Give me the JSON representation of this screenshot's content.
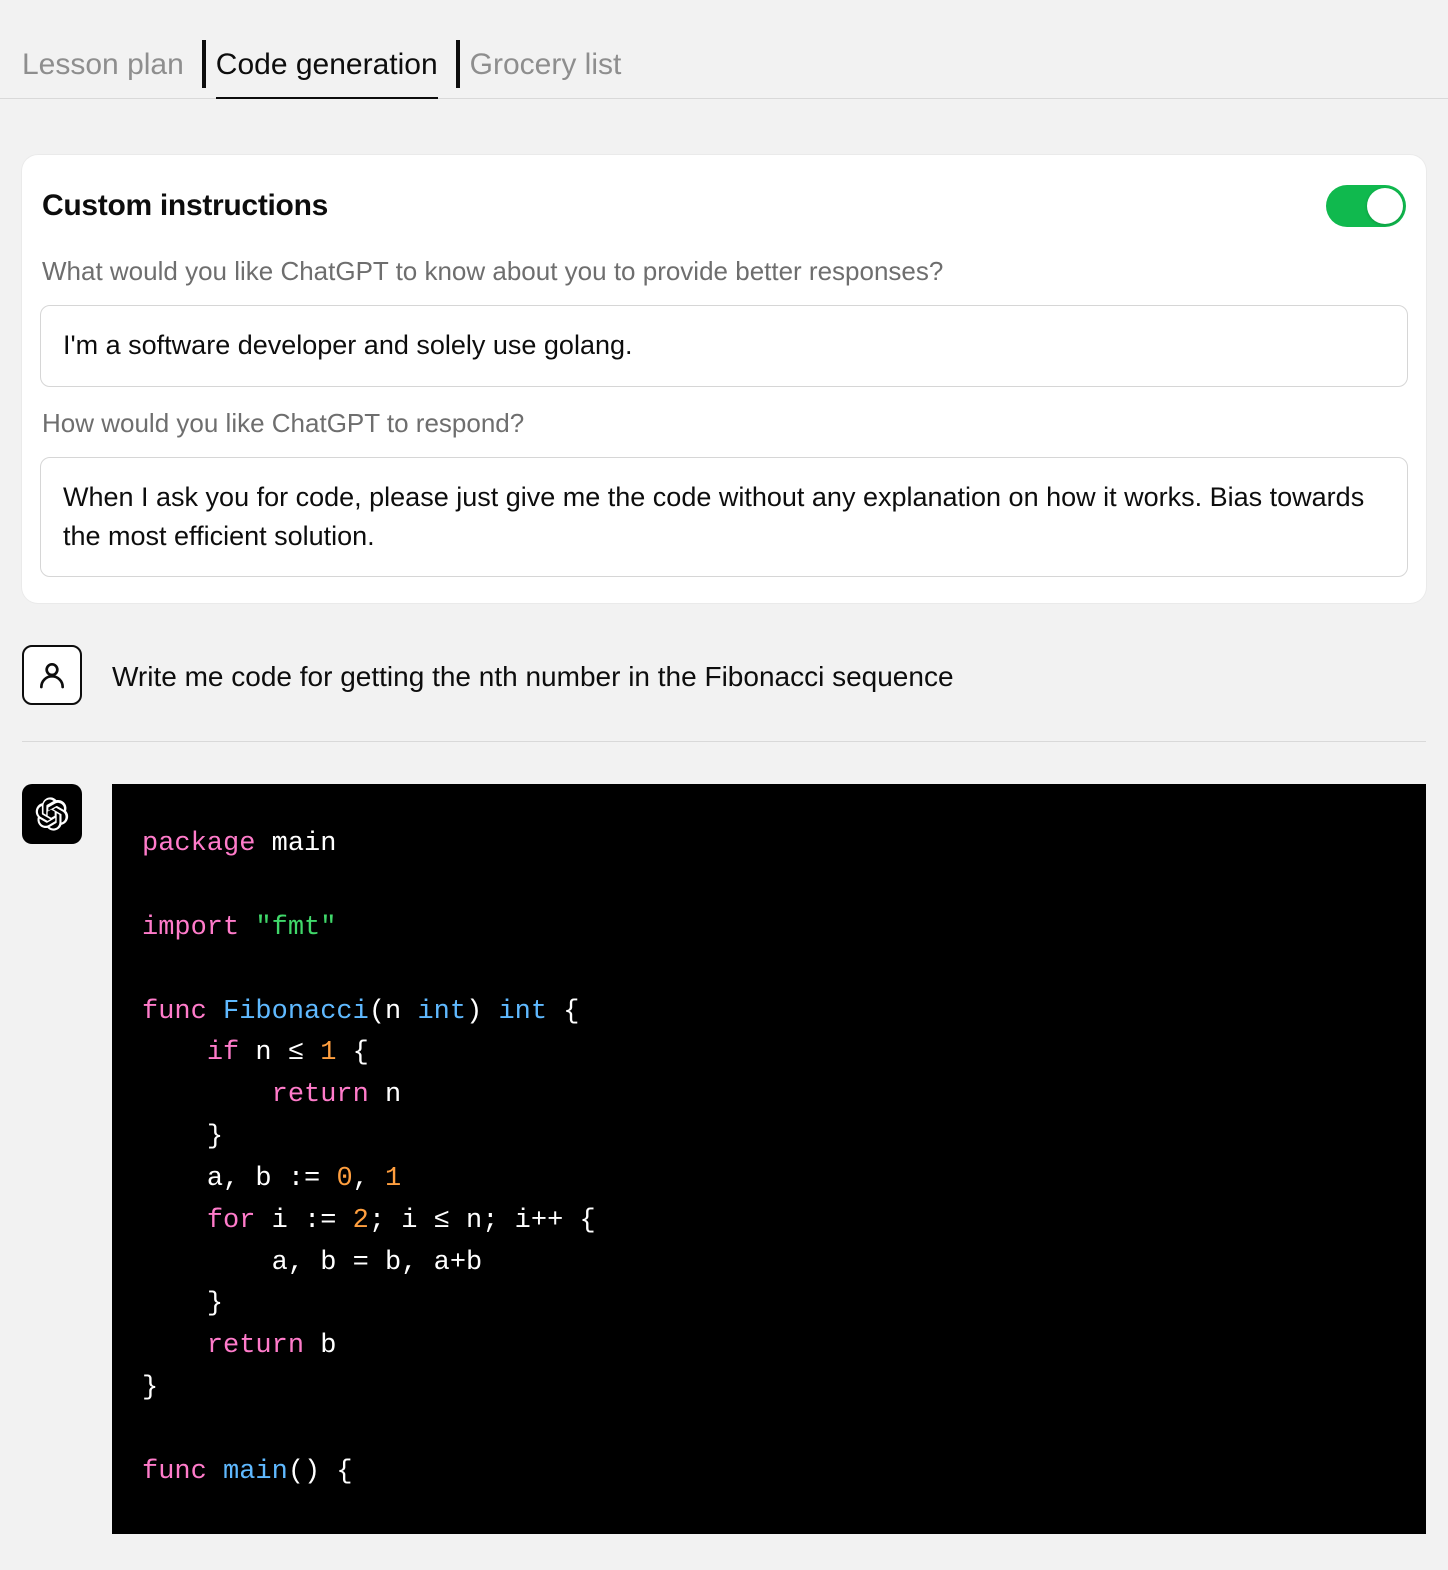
{
  "tabs": [
    {
      "label": "Lesson plan",
      "active": false
    },
    {
      "label": "Code generation",
      "active": true
    },
    {
      "label": "Grocery list",
      "active": false
    }
  ],
  "custom_instructions": {
    "title": "Custom instructions",
    "toggle_on": true,
    "q1_label": "What would you like ChatGPT to know about you to provide better responses?",
    "q1_value": "I'm a software developer and solely use golang.",
    "q2_label": "How would you like ChatGPT to respond?",
    "q2_value": "When I ask you for code, please just give me the code without any explanation on how it works. Bias towards the most efficient solution."
  },
  "conversation": {
    "user_prompt": "Write me code for getting the nth number in the Fibonacci sequence",
    "code_tokens": [
      {
        "t": "kw",
        "s": "package"
      },
      {
        "t": "sp",
        "s": " "
      },
      {
        "t": "id",
        "s": "main"
      },
      {
        "t": "nl"
      },
      {
        "t": "nl"
      },
      {
        "t": "kw",
        "s": "import"
      },
      {
        "t": "sp",
        "s": " "
      },
      {
        "t": "str",
        "s": "\"fmt\""
      },
      {
        "t": "nl"
      },
      {
        "t": "nl"
      },
      {
        "t": "kw",
        "s": "func"
      },
      {
        "t": "sp",
        "s": " "
      },
      {
        "t": "fn",
        "s": "Fibonacci"
      },
      {
        "t": "id",
        "s": "(n "
      },
      {
        "t": "type",
        "s": "int"
      },
      {
        "t": "id",
        "s": ") "
      },
      {
        "t": "type",
        "s": "int"
      },
      {
        "t": "id",
        "s": " {"
      },
      {
        "t": "nl"
      },
      {
        "t": "sp",
        "s": "    "
      },
      {
        "t": "kw",
        "s": "if"
      },
      {
        "t": "id",
        "s": " n ≤ "
      },
      {
        "t": "num",
        "s": "1"
      },
      {
        "t": "id",
        "s": " {"
      },
      {
        "t": "nl"
      },
      {
        "t": "sp",
        "s": "        "
      },
      {
        "t": "kw",
        "s": "return"
      },
      {
        "t": "id",
        "s": " n"
      },
      {
        "t": "nl"
      },
      {
        "t": "sp",
        "s": "    "
      },
      {
        "t": "id",
        "s": "}"
      },
      {
        "t": "nl"
      },
      {
        "t": "sp",
        "s": "    "
      },
      {
        "t": "id",
        "s": "a, b := "
      },
      {
        "t": "num",
        "s": "0"
      },
      {
        "t": "id",
        "s": ", "
      },
      {
        "t": "num",
        "s": "1"
      },
      {
        "t": "nl"
      },
      {
        "t": "sp",
        "s": "    "
      },
      {
        "t": "kw",
        "s": "for"
      },
      {
        "t": "id",
        "s": " i := "
      },
      {
        "t": "num",
        "s": "2"
      },
      {
        "t": "id",
        "s": "; i ≤ n; i++ {"
      },
      {
        "t": "nl"
      },
      {
        "t": "sp",
        "s": "        "
      },
      {
        "t": "id",
        "s": "a, b = b, a+b"
      },
      {
        "t": "nl"
      },
      {
        "t": "sp",
        "s": "    "
      },
      {
        "t": "id",
        "s": "}"
      },
      {
        "t": "nl"
      },
      {
        "t": "sp",
        "s": "    "
      },
      {
        "t": "kw",
        "s": "return"
      },
      {
        "t": "id",
        "s": " b"
      },
      {
        "t": "nl"
      },
      {
        "t": "id",
        "s": "}"
      },
      {
        "t": "nl"
      },
      {
        "t": "nl"
      },
      {
        "t": "kw",
        "s": "func"
      },
      {
        "t": "sp",
        "s": " "
      },
      {
        "t": "fn",
        "s": "main"
      },
      {
        "t": "id",
        "s": "() {"
      },
      {
        "t": "nl"
      }
    ]
  }
}
